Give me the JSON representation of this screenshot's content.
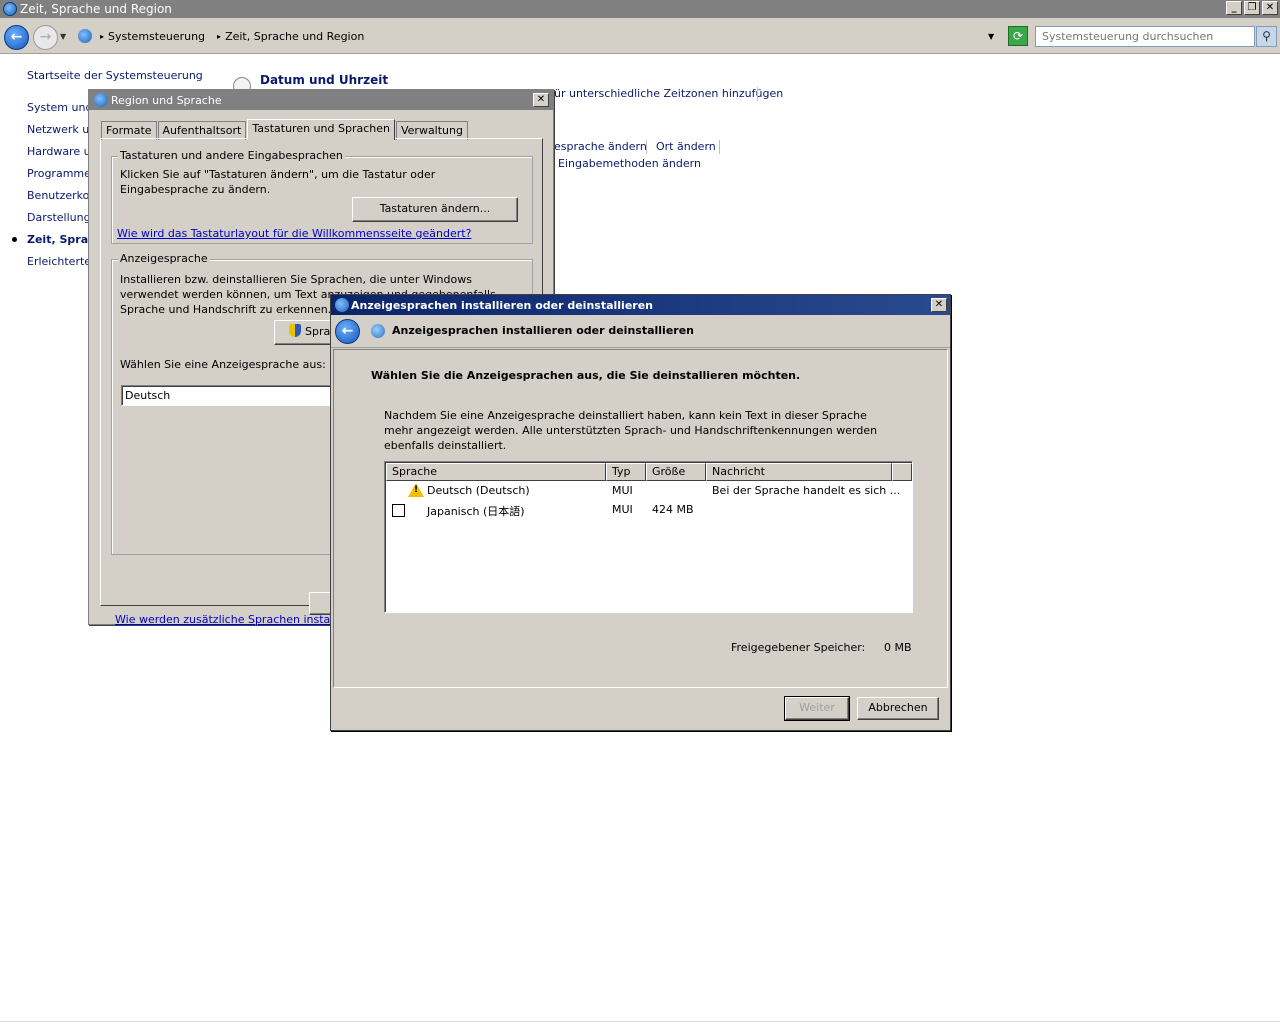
{
  "window": {
    "title": "Zeit, Sprache und Region"
  },
  "address_bar": {
    "crumbs": [
      "Systemsteuerung",
      "Zeit, Sprache und Region"
    ],
    "search_placeholder": "Systemsteuerung durchsuchen"
  },
  "left_nav": {
    "items": [
      "Startseite der Systemsteuerung",
      "System und S",
      "Netzwerk un",
      "Hardware un",
      "Programme",
      "Benutzerkon",
      "Darstellung u",
      "Zeit, Sprac",
      "Erleichterte E"
    ]
  },
  "content": {
    "section_title": "Datum und Uhrzeit",
    "link_timezones": "ür unterschiedliche Zeitzonen hinzufügen",
    "link_language": "esprache ändern",
    "link_location": "Ort ändern",
    "link_input": "Eingabemethoden ändern"
  },
  "region_dialog": {
    "title": "Region und Sprache",
    "tabs": [
      "Formate",
      "Aufenthaltsort",
      "Tastaturen und Sprachen",
      "Verwaltung"
    ],
    "group1": {
      "legend": "Tastaturen und andere Eingabesprachen",
      "text": "Klicken Sie auf \"Tastaturen ändern\", um die Tastatur oder Eingabesprache zu ändern.",
      "button": "Tastaturen ändern...",
      "link": "Wie wird das Tastaturlayout für die Willkommensseite geändert?"
    },
    "group2": {
      "legend": "Anzeigesprache",
      "text": "Installieren bzw. deinstallieren Sie Sprachen, die unter Windows verwendet werden können, um Text anzuzeigen und gegebenenfalls Sprache und Handschrift zu erkennen.",
      "button": "Spra",
      "select_label": "Wählen Sie eine Anzeigesprache aus:",
      "selected": "Deutsch"
    },
    "bottom_link": "Wie werden zusätzliche Sprachen installie"
  },
  "lang_dialog": {
    "title": "Anzeigesprachen installieren oder deinstallieren",
    "header": "Anzeigesprachen installieren oder deinstallieren",
    "instruction": "Wählen Sie die Anzeigesprachen aus, die Sie deinstallieren möchten.",
    "description": "Nachdem Sie eine Anzeigesprache deinstalliert haben, kann kein Text in dieser Sprache mehr angezeigt werden. Alle unterstützten Sprach- und Handschriftenkennungen werden ebenfalls deinstalliert.",
    "columns": [
      "Sprache",
      "Typ",
      "Größe",
      "Nachricht"
    ],
    "rows": [
      {
        "language": "Deutsch (Deutsch)",
        "type": "MUI",
        "size": "",
        "message": "Bei der Sprache handelt es sich ..."
      },
      {
        "language": "Japanisch (日本語)",
        "type": "MUI",
        "size": "424 MB",
        "message": ""
      }
    ],
    "freed_label": "Freigegebener Speicher:",
    "freed_value": "0 MB",
    "next_button": "Weiter",
    "cancel_button": "Abbrechen"
  }
}
